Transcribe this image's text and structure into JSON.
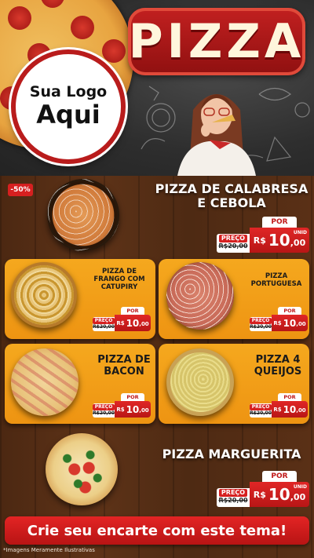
{
  "colors": {
    "red": "#d62020",
    "orange_card": "#f5a81e",
    "wood": "#5a3018",
    "chalkboard": "#2e2e2e"
  },
  "header": {
    "logo_line1": "Sua Logo",
    "logo_line2": "Aqui",
    "title": "PIZZA"
  },
  "featured": {
    "discount": "-50%",
    "name_line1": "PIZZA DE CALABRESA",
    "name_line2": "E CEBOLA",
    "price_label": "PREÇO",
    "old_price": "R$20,00",
    "por": "POR",
    "currency": "R$",
    "amount": "10",
    "cents": ",00",
    "unit": "UNID"
  },
  "products": [
    {
      "name_lines": [
        "PIZZA DE",
        "FRANGO COM",
        "CATUPIRY"
      ],
      "price_label": "PREÇO",
      "old_price": "R$20,00",
      "por": "POR",
      "currency": "R$",
      "amount": "10",
      "cents": ",00",
      "unit": "UNID"
    },
    {
      "name_lines": [
        "PIZZA",
        "PORTUGUESA"
      ],
      "price_label": "PREÇO",
      "old_price": "R$20,00",
      "por": "POR",
      "currency": "R$",
      "amount": "10",
      "cents": ",00",
      "unit": "UNID"
    },
    {
      "name_lines": [
        "PIZZA DE",
        "BACON"
      ],
      "price_label": "PREÇO",
      "old_price": "R$20,00",
      "por": "POR",
      "currency": "R$",
      "amount": "10",
      "cents": ",00",
      "unit": "UNID"
    },
    {
      "name_lines": [
        "PIZZA 4",
        "QUEIJOS"
      ],
      "price_label": "PREÇO",
      "old_price": "R$20,00",
      "por": "POR",
      "currency": "R$",
      "amount": "10",
      "cents": ",00",
      "unit": "UNID"
    }
  ],
  "bottom": {
    "name": "PIZZA MARGUERITA",
    "price_label": "PREÇO",
    "old_price": "R$20,00",
    "por": "POR",
    "currency": "R$",
    "amount": "10",
    "cents": ",00",
    "unit": "UNID"
  },
  "footer": {
    "banner": "Crie seu encarte com este tema!",
    "note": "*Imagens Meramente Ilustrativas"
  }
}
